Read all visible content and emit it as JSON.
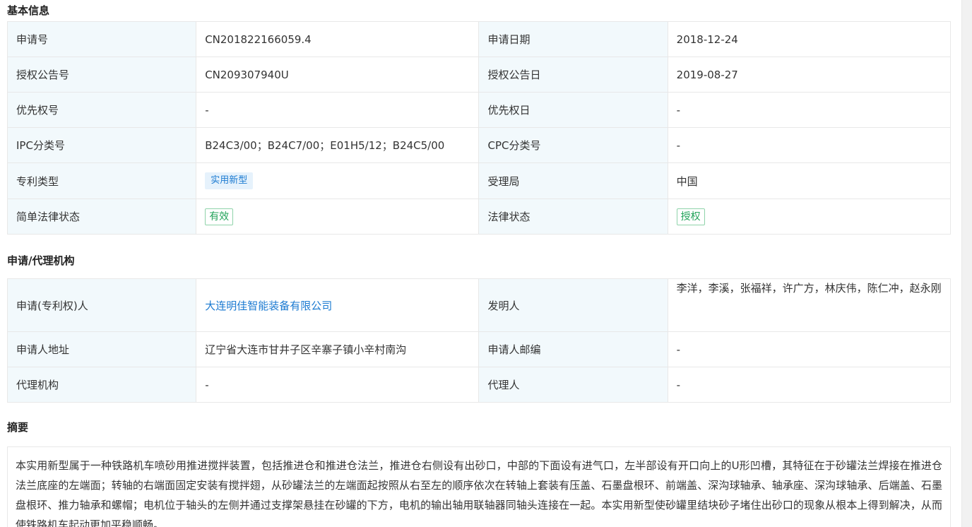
{
  "sections": {
    "basic": {
      "title": "基本信息",
      "rows": [
        {
          "l1": "申请号",
          "v1": "CN201822166059.4",
          "l2": "申请日期",
          "v2": "2018-12-24"
        },
        {
          "l1": "授权公告号",
          "v1": "CN209307940U",
          "l2": "授权公告日",
          "v2": "2019-08-27"
        },
        {
          "l1": "优先权号",
          "v1": "-",
          "l2": "优先权日",
          "v2": "-"
        },
        {
          "l1": "IPC分类号",
          "v1": "B24C3/00；B24C7/00；E01H5/12；B24C5/00",
          "l2": "CPC分类号",
          "v2": "-"
        },
        {
          "l1": "专利类型",
          "v1": "实用新型",
          "l2": "受理局",
          "v2": "中国"
        },
        {
          "l1": "简单法律状态",
          "v1": "有效",
          "l2": "法律状态",
          "v2": "授权"
        }
      ]
    },
    "applicant": {
      "title": "申请/代理机构",
      "rows": [
        {
          "l1": "申请(专利权)人",
          "v1": "大连明佳智能装备有限公司",
          "l2": "发明人",
          "v2": "李洋，李溪，张福祥，许广方，林庆伟，陈仁冲，赵永刚"
        },
        {
          "l1": "申请人地址",
          "v1": "辽宁省大连市甘井子区辛寨子镇小辛村南沟",
          "l2": "申请人邮编",
          "v2": "-"
        },
        {
          "l1": "代理机构",
          "v1": "-",
          "l2": "代理人",
          "v2": "-"
        }
      ]
    },
    "abstract": {
      "title": "摘要",
      "text": "本实用新型属于一种铁路机车喷砂用推进搅拌装置，包括推进仓和推进仓法兰，推进仓右侧设有出砂口，中部的下面设有进气口，左半部设有开口向上的U形凹槽，其特征在于砂罐法兰焊接在推进仓法兰底座的左端面；转轴的右端面固定安装有搅拌翅，从砂罐法兰的左端面起按照从右至左的顺序依次在转轴上套装有压盖、石墨盘根环、前端盖、深沟球轴承、轴承座、深沟球轴承、后端盖、石墨盘根环、推力轴承和螺帽；电机位于轴头的左侧并通过支撑架悬挂在砂罐的下方，电机的输出轴用联轴器同轴头连接在一起。本实用新型使砂罐里结块砂子堵住出砂口的现象从根本上得到解决，从而使铁路机车起动更加平稳顺畅。"
    }
  },
  "colors": {
    "label_bg": "#f2f9fc",
    "border": "#e8e8e8",
    "link": "#1b7ad1",
    "tag_blue_bg": "#e6f2fc",
    "tag_green": "#23a35a"
  }
}
